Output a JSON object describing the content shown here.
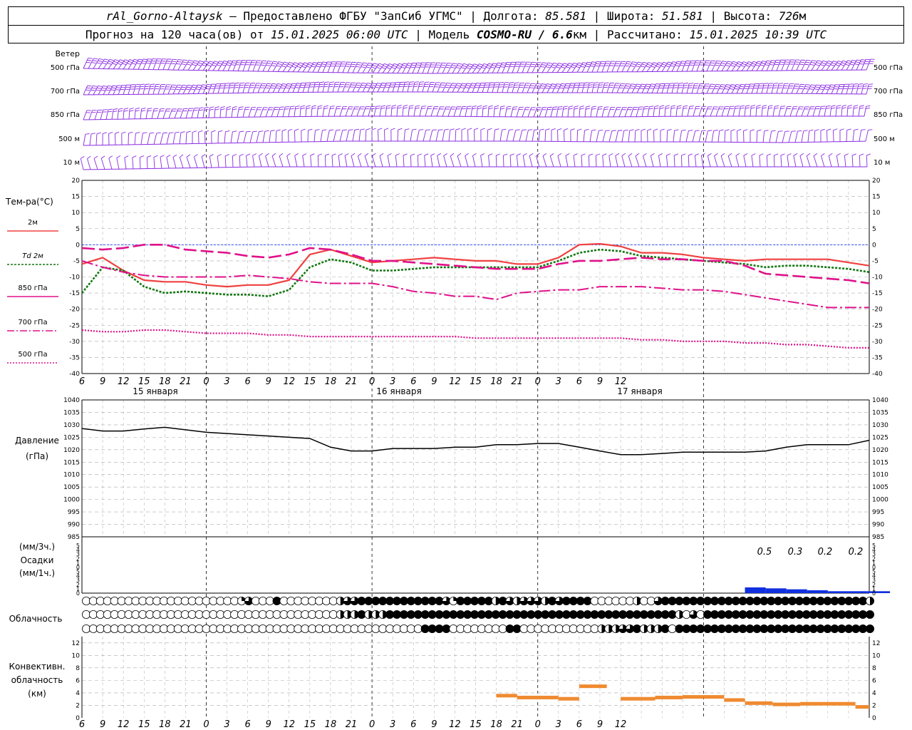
{
  "header": {
    "station": "rAl_Gorno-Altaysk",
    "dash": " – ",
    "provided_by": "Предоставлено ФГБУ \"ЗапСиб УГМС\"",
    "sep": " | ",
    "lon_label": "Долгота: ",
    "lon": "85.581",
    "lat_label": "Широта: ",
    "lat": "51.581",
    "alt_label": "Высота: ",
    "alt": "726",
    "alt_unit": "м",
    "forecast_label": "Прогноз на 120 часа(ов) от ",
    "forecast_start": "15.01.2025 06:00 UTC",
    "model_label": "Модель ",
    "model": "COSMO-RU / 6.6",
    "model_unit": "км",
    "computed_label": "Рассчитано: ",
    "computed": "15.01.2025 10:39 UTC"
  },
  "colors": {
    "wind": "#8a2be2",
    "t2m": "#f04040",
    "td2m": "#117711",
    "t850": "#e0108a",
    "t700": "#e0108a",
    "t500": "#e0108a",
    "pressure": "#000000",
    "precip": "#1030e0",
    "convective": "#f08a30",
    "grid": "#aaaaaa",
    "zero_line": "#3050ff"
  },
  "axis": {
    "x_hour_labels": [
      "6",
      "9",
      "12",
      "15",
      "18",
      "21",
      "0",
      "3",
      "6",
      "9",
      "12",
      "15",
      "18",
      "21",
      "0",
      "3",
      "6",
      "9",
      "12",
      "15",
      "18",
      "21",
      "0",
      "3",
      "6",
      "9",
      "12"
    ],
    "day_labels": [
      "15 января",
      "16 января",
      "17 января"
    ],
    "temp_ticks": [
      "20",
      "15",
      "10",
      "5",
      "0",
      "-5",
      "-10",
      "-15",
      "-20",
      "-25",
      "-30",
      "-35",
      "-40"
    ],
    "pressure_ticks": [
      "1040",
      "1035",
      "1030",
      "1025",
      "1020",
      "1015",
      "1010",
      "1005",
      "1000",
      "995",
      "990",
      "985"
    ],
    "precip_ticks": [
      "5",
      "4",
      "3",
      "2",
      "1",
      "0",
      "5",
      "4",
      "3",
      "2",
      "1",
      "0"
    ],
    "conv_ticks": [
      "12",
      "10",
      "8",
      "6",
      "4",
      "2",
      "0"
    ]
  },
  "wind_panel": {
    "title": "Ветер",
    "levels": [
      "500 гПа",
      "700 гПа",
      "850 гПа",
      "500 м",
      "10  м"
    ]
  },
  "temp_panel": {
    "title": "Тем-ра(°C)",
    "legend": [
      {
        "label": "2м",
        "style": "solid"
      },
      {
        "label": "Td 2м",
        "style": "dotted"
      },
      {
        "label": "850 гПа",
        "style": "dash-long"
      },
      {
        "label": "700 гПа",
        "style": "dash-dot"
      },
      {
        "label": "500 гПа",
        "style": "dotted-fine"
      }
    ]
  },
  "pressure_panel": {
    "title_line1": "Давление",
    "title_line2": "(гПа)"
  },
  "precip_panel": {
    "title_line1": "(мм/3ч.)",
    "title_line2": "Осадки",
    "title_line3": "(мм/1ч.)",
    "daily_totals": [
      "0.5",
      "0.3",
      "0.2",
      "0.2"
    ]
  },
  "cloud_panel": {
    "title": "Облачность"
  },
  "conv_panel": {
    "title_line1": "Конвективн.",
    "title_line2": "облачность",
    "title_line3": "(км)"
  },
  "chart_data": [
    {
      "type": "line",
      "title": "Тем-ра(°C)",
      "ylim": [
        -40,
        20
      ],
      "x_hours_from_start": [
        0,
        3,
        6,
        9,
        12,
        15,
        18,
        21,
        24,
        27,
        30,
        33,
        36,
        39,
        42,
        45,
        48,
        51,
        54,
        57,
        60,
        63,
        66,
        69,
        72,
        75,
        78,
        81,
        84,
        87,
        90,
        93,
        96,
        99,
        102,
        105,
        108,
        111,
        114
      ],
      "series": [
        {
          "name": "2м",
          "values": [
            -6,
            -4,
            -8,
            -11,
            -11.5,
            -11.5,
            -12.5,
            -13,
            -12.5,
            -12.5,
            -11,
            -3,
            -1.5,
            -3.5,
            -5.5,
            -5,
            -4.5,
            -4,
            -4.5,
            -5,
            -5,
            -6,
            -6,
            -4,
            0,
            0.3,
            -0.5,
            -2.5,
            -2.5,
            -3,
            -4,
            -4.5,
            -5,
            -4.5,
            -4.5,
            -4.5,
            -4.5,
            -5.5,
            -6.5
          ]
        },
        {
          "name": "Td 2м",
          "values": [
            -15,
            -7,
            -8,
            -13,
            -15,
            -14.5,
            -15,
            -15.5,
            -15.5,
            -16,
            -14,
            -7,
            -4.5,
            -5.5,
            -8,
            -8,
            -7.5,
            -7,
            -7,
            -7,
            -7,
            -7,
            -7,
            -5,
            -2.5,
            -1.5,
            -2,
            -3.5,
            -4,
            -4.5,
            -5,
            -5.5,
            -6,
            -7,
            -6.5,
            -6.5,
            -7,
            -7.5,
            -8.5
          ]
        },
        {
          "name": "850 гПа",
          "values": [
            -1,
            -1.5,
            -1,
            0,
            0,
            -1.5,
            -2,
            -2.5,
            -3.5,
            -4,
            -3,
            -1,
            -1.5,
            -3,
            -5,
            -5,
            -5.5,
            -6,
            -6.5,
            -7,
            -7.5,
            -7.5,
            -7.5,
            -6,
            -5,
            -5,
            -4.5,
            -4,
            -4.5,
            -4.5,
            -5,
            -5,
            -6.5,
            -9,
            -9.5,
            -10,
            -10.5,
            -11,
            -12
          ]
        },
        {
          "name": "700 гПа",
          "values": [
            -5,
            -7,
            -8.5,
            -9.5,
            -10,
            -10,
            -10,
            -10,
            -9.5,
            -10,
            -10.5,
            -11.5,
            -12,
            -12,
            -12,
            -13,
            -14.5,
            -15,
            -16,
            -16,
            -17,
            -15,
            -14.5,
            -14,
            -14,
            -13,
            -13,
            -13,
            -13.5,
            -14,
            -14,
            -14.5,
            -15.5,
            -16.5,
            -17.5,
            -18.5,
            -19.5,
            -19.5,
            -19.5
          ]
        },
        {
          "name": "500 гПа",
          "values": [
            -26.5,
            -27,
            -27,
            -26.5,
            -26.5,
            -27,
            -27.5,
            -27.5,
            -27.5,
            -28,
            -28,
            -28.5,
            -28.5,
            -28.5,
            -28.5,
            -28.5,
            -28.5,
            -28.5,
            -28.5,
            -29,
            -29,
            -29,
            -29,
            -29,
            -29,
            -29,
            -29,
            -29.5,
            -29.5,
            -30,
            -30,
            -30,
            -30.5,
            -30.5,
            -31,
            -31,
            -31.5,
            -32,
            -32
          ]
        }
      ]
    },
    {
      "type": "line",
      "title": "Давление",
      "ylabel": "(гПа)",
      "ylim": [
        985,
        1040
      ],
      "x_hours_from_start": [
        0,
        3,
        6,
        9,
        12,
        15,
        18,
        21,
        24,
        27,
        30,
        33,
        36,
        39,
        42,
        45,
        48,
        51,
        54,
        57,
        60,
        63,
        66,
        69,
        72,
        75,
        78,
        81,
        84,
        87,
        90,
        93,
        96,
        99,
        102,
        105,
        108,
        111,
        114
      ],
      "series": [
        {
          "name": "",
          "values": [
            1028.5,
            1027.5,
            1027.5,
            1028.3,
            1029,
            1028,
            1027,
            1026.5,
            1026,
            1025.5,
            1025,
            1024.5,
            1021,
            1019.5,
            1019.5,
            1020.5,
            1020.5,
            1020.5,
            1021,
            1021,
            1022,
            1022,
            1022.5,
            1022.5,
            1021,
            1019.5,
            1018,
            1018,
            1018.5,
            1019,
            1019,
            1019,
            1019,
            1019.5,
            1021,
            1022,
            1022,
            1022,
            1023.8
          ]
        }
      ]
    },
    {
      "type": "bar",
      "title": "Осадки",
      "ylabel": "(мм/1ч.)",
      "ylim": [
        0,
        5
      ],
      "x_hours_from_start": [
        96,
        99,
        102,
        105,
        108,
        111,
        114
      ],
      "values": [
        0.3,
        0.25,
        0.2,
        0.15,
        0.1,
        0.1,
        0.1
      ]
    },
    {
      "type": "bar",
      "title": "Конвективн. облачность",
      "ylabel": "(км)",
      "ylim": [
        0,
        13
      ],
      "segments": [
        {
          "x0": 60,
          "x1": 63,
          "value": 3.5
        },
        {
          "x0": 63,
          "x1": 69,
          "value": 3.2
        },
        {
          "x0": 69,
          "x1": 72,
          "value": 3.0
        },
        {
          "x0": 72,
          "x1": 76,
          "value": 5.0
        },
        {
          "x0": 78,
          "x1": 83,
          "value": 3.0
        },
        {
          "x0": 83,
          "x1": 87,
          "value": 3.2
        },
        {
          "x0": 87,
          "x1": 90,
          "value": 3.3
        },
        {
          "x0": 90,
          "x1": 93,
          "value": 3.3
        },
        {
          "x0": 93,
          "x1": 96,
          "value": 2.8
        },
        {
          "x0": 96,
          "x1": 100,
          "value": 2.3
        },
        {
          "x0": 100,
          "x1": 104,
          "value": 2.1
        },
        {
          "x0": 104,
          "x1": 112,
          "value": 2.2
        },
        {
          "x0": 112,
          "x1": 114,
          "value": 1.7
        }
      ]
    },
    {
      "type": "table",
      "title": "Облачность",
      "x_hours_from_start_step": 1,
      "rows": [
        {
          "level": "upper",
          "codes": "0000000000000000000000130004000000002334444444444443144444243233324344440000002003444444444444444444444444444442"
        },
        {
          "level": "middle",
          "codes": "0000000000000000000000000000000000002224222444444444444444444444444444444444444444442030444444444444444444444444"
        },
        {
          "level": "lower",
          "codes": "0000000000000000000000000000000000000000000000004444000000004400000000000222334222404444444444444444444444444444"
        }
      ]
    },
    {
      "type": "scatter",
      "title": "Ветер",
      "levels": [
        "500 гПа",
        "700 гПа",
        "850 гПа",
        "500 м",
        "10  м"
      ],
      "x_hours_from_start_step": 1,
      "series": [
        {
          "name": "500 гПа",
          "direction_deg": 250,
          "speed_ms": 30
        },
        {
          "name": "700 гПа",
          "direction_deg": 260,
          "speed_ms": 25
        },
        {
          "name": "850 гПа",
          "direction_deg": 250,
          "speed_ms": 15
        },
        {
          "name": "500 м",
          "direction_deg": 200,
          "speed_ms": 8
        },
        {
          "name": "10  м",
          "direction_deg": 190,
          "speed_ms": 3
        }
      ]
    }
  ]
}
